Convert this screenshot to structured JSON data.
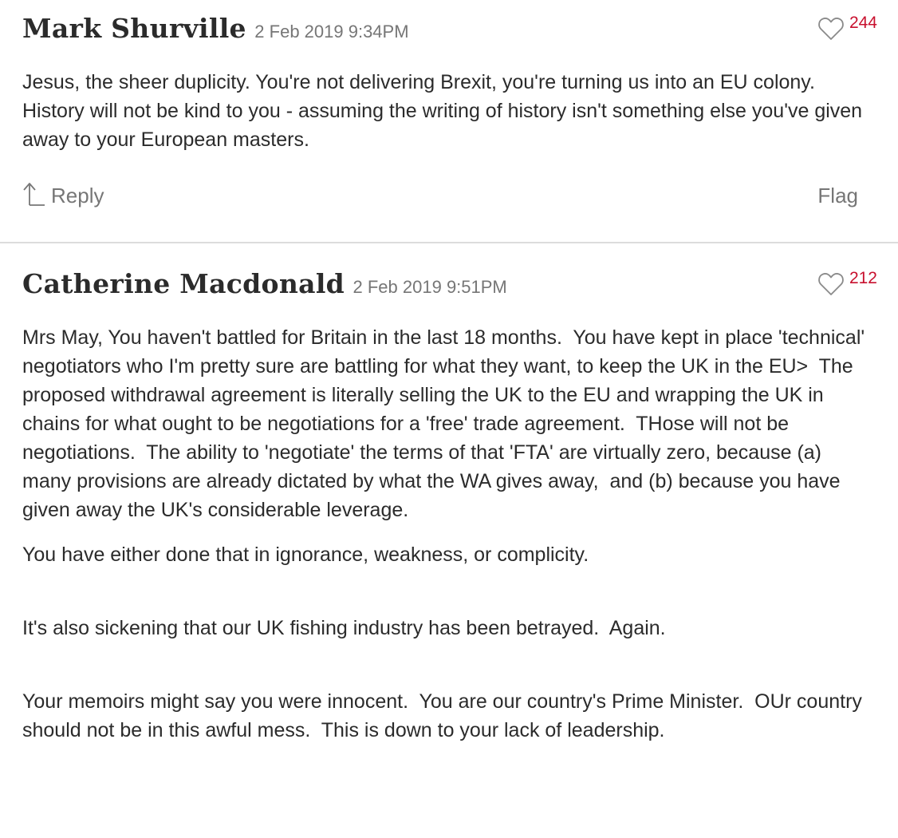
{
  "comments": [
    {
      "author": "Mark Shurville",
      "timestamp": "2 Feb 2019 9:34PM",
      "likes": "244",
      "paragraphs": [
        "Jesus, the sheer duplicity. You're not delivering Brexit, you're turning us into an EU colony. History will not be kind to you - assuming the writing of history isn't something else you've given away to your European masters."
      ],
      "reply_label": "Reply",
      "flag_label": "Flag"
    },
    {
      "author": "Catherine Macdonald",
      "timestamp": "2 Feb 2019 9:51PM",
      "likes": "212",
      "paragraphs": [
        "Mrs May, You haven't battled for Britain in the last 18 months.  You have kept in place 'technical' negotiators who I'm pretty sure are battling for what they want, to keep the UK in the EU>  The proposed withdrawal agreement is literally selling the UK to the EU and wrapping the UK in chains for what ought to be negotiations for a 'free' trade agreement.  THose will not be negotiations.  The ability to 'negotiate' the terms of that 'FTA' are virtually zero, because (a) many provisions are already dictated by what the WA gives away,  and (b) because you have given away the UK's considerable leverage.",
        "You have either done that in ignorance, weakness, or complicity.",
        "It's also sickening that our UK fishing industry has been betrayed.  Again.",
        "Your memoirs might say you were innocent.  You are our country's Prime Minister.  OUr country should not be in this awful mess.  This is down to your lack of leadership."
      ]
    }
  ],
  "icons": {
    "like": "heart-outline-icon",
    "reply": "reply-arrow-icon"
  },
  "colors": {
    "like_count": "#c8102e",
    "text": "#2b2b2b",
    "muted": "#767676",
    "divider": "#dcdcdc"
  }
}
